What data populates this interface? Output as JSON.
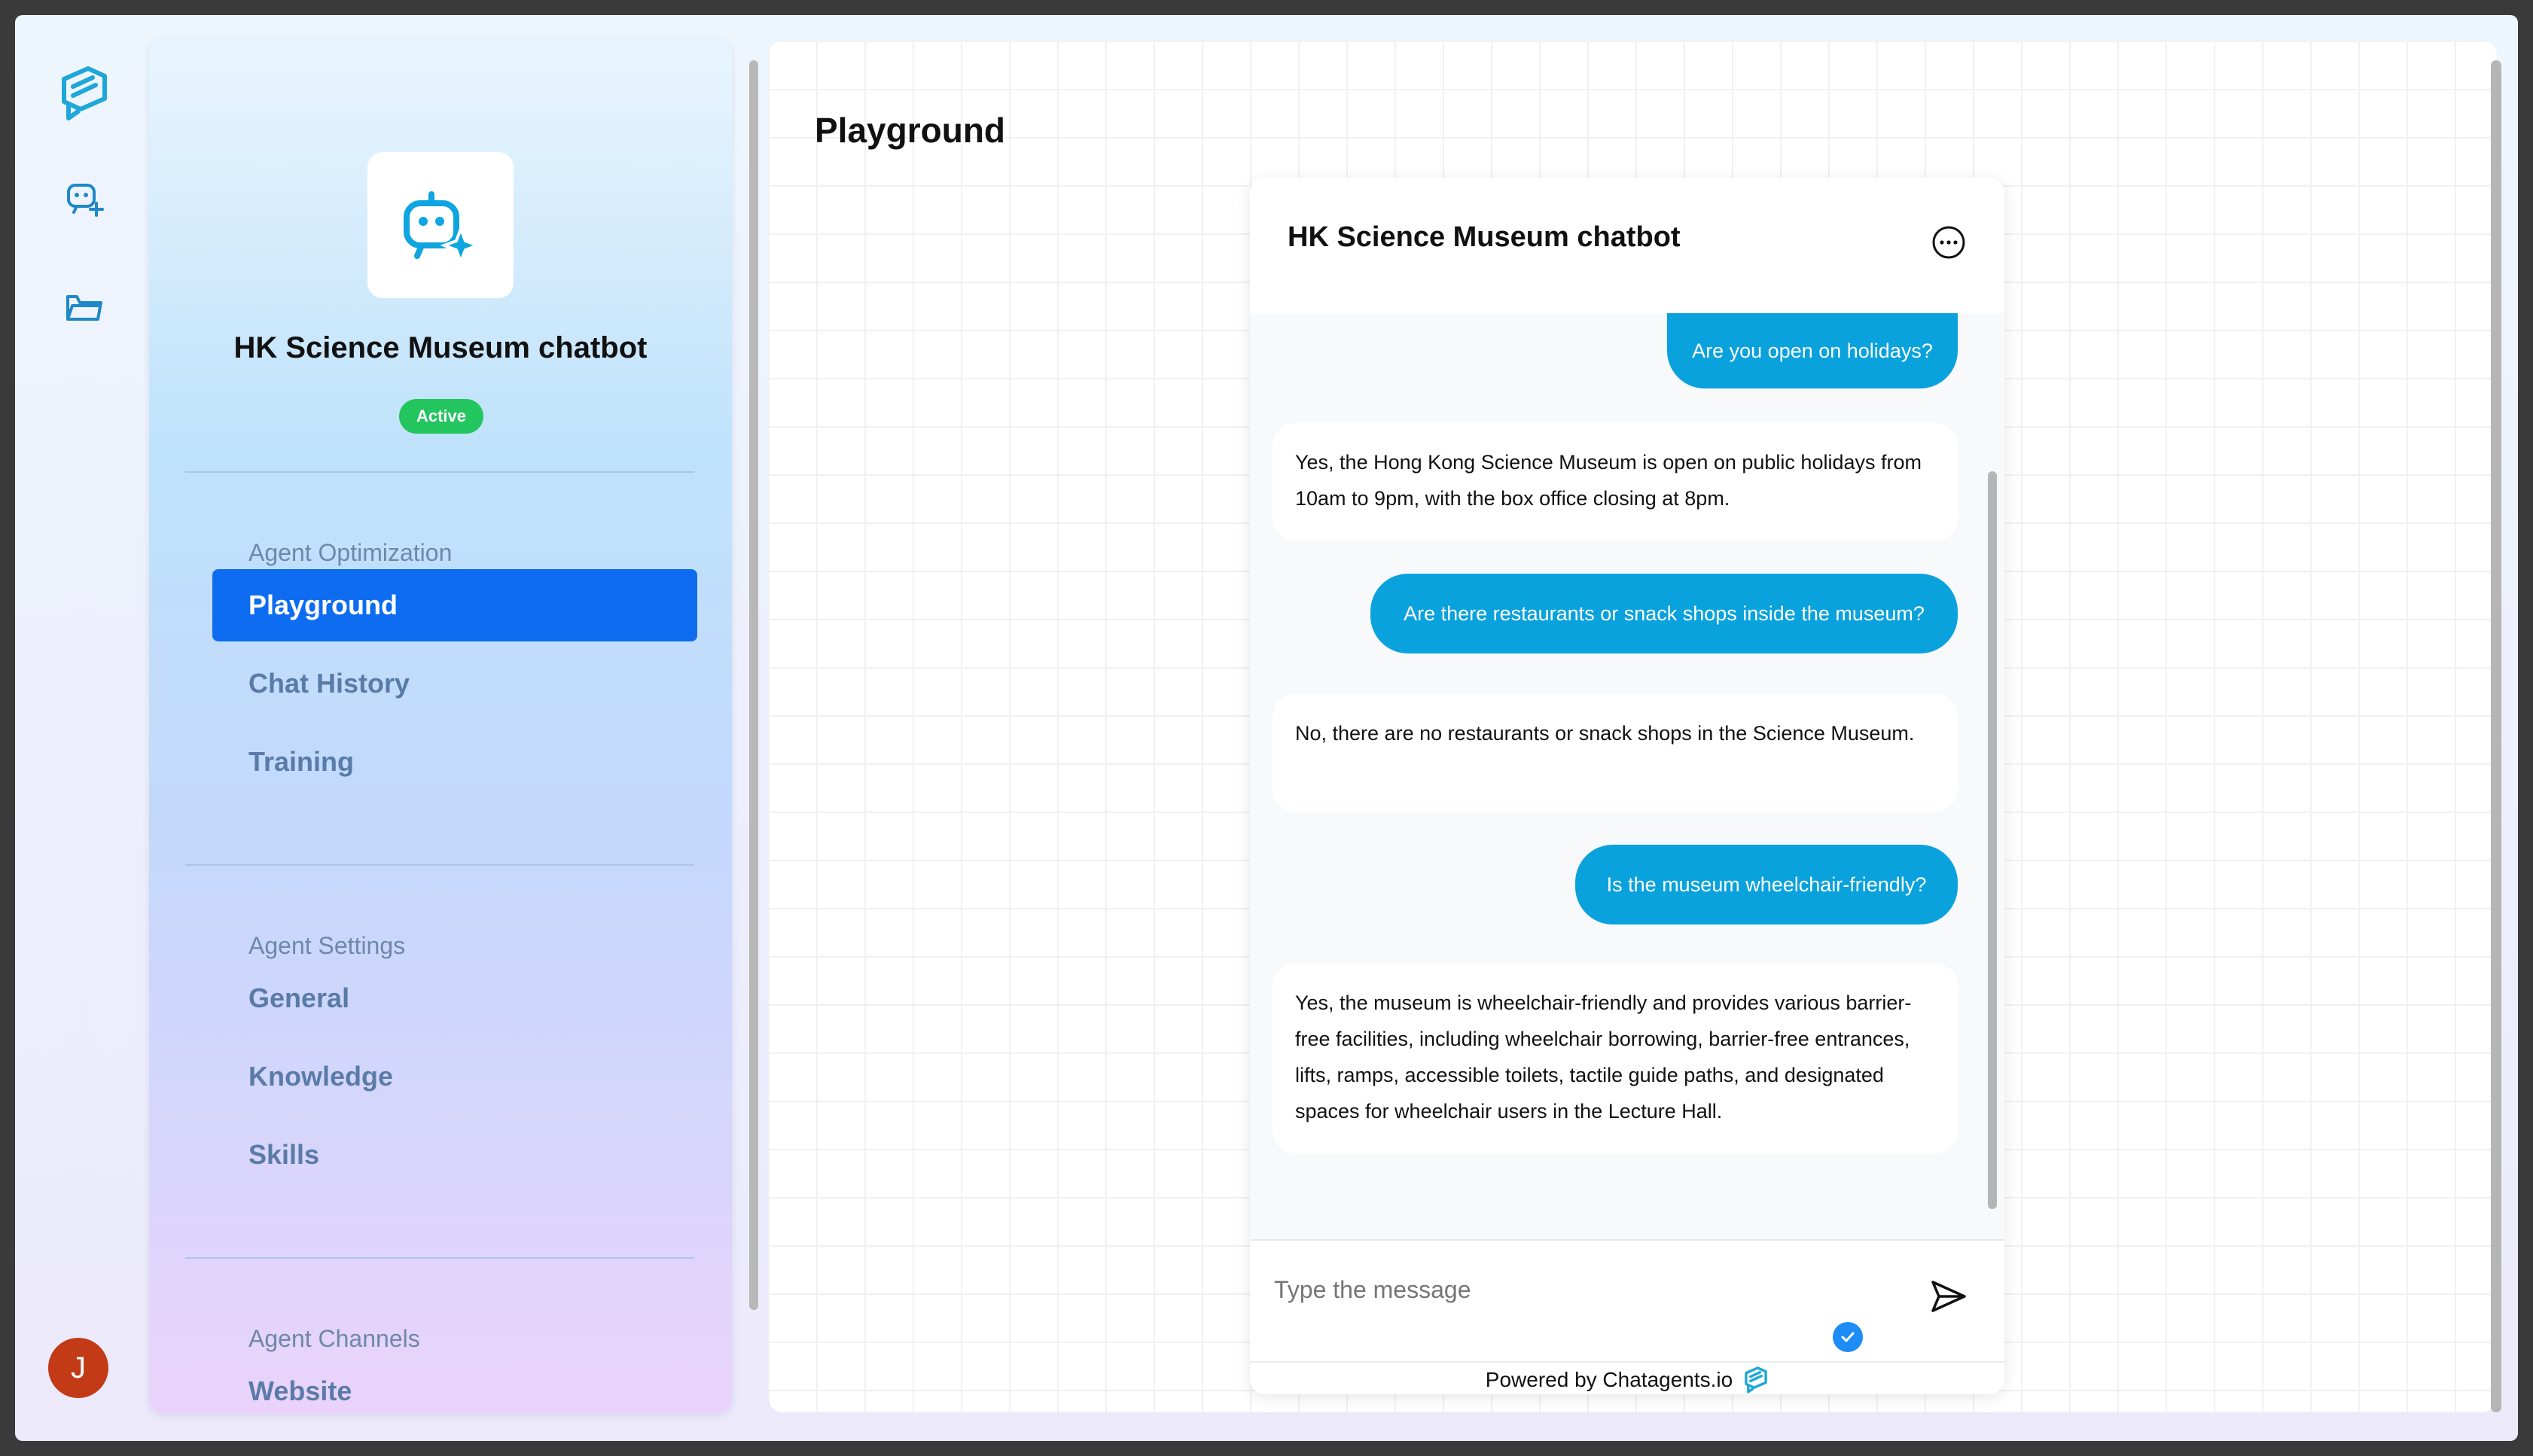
{
  "rail": {
    "icons": [
      "brand-logo-icon",
      "chatbot-add-icon",
      "folder-icon"
    ],
    "user_initial": "J"
  },
  "agent": {
    "name": "HK Science Museum chatbot",
    "status": "Active"
  },
  "sidebar": {
    "sections": [
      {
        "label": "Agent Optimization",
        "items": [
          "Playground",
          "Chat History",
          "Training"
        ]
      },
      {
        "label": "Agent Settings",
        "items": [
          "General",
          "Knowledge",
          "Skills"
        ]
      },
      {
        "label": "Agent Channels",
        "items": [
          "Website"
        ]
      }
    ],
    "active_item": "Playground"
  },
  "main": {
    "title": "Playground"
  },
  "chat": {
    "title": "HK Science Museum chatbot",
    "messages": [
      {
        "role": "user",
        "text": "Are you open on holidays?"
      },
      {
        "role": "bot",
        "text": "Yes, the Hong Kong Science Museum is open on public holidays from 10am to 9pm, with the box office closing at 8pm."
      },
      {
        "role": "user",
        "text": "Are there restaurants or snack shops inside the museum?"
      },
      {
        "role": "bot",
        "text": "No, there are no restaurants or snack shops in the Science Museum."
      },
      {
        "role": "user",
        "text": "Is the museum wheelchair-friendly?"
      },
      {
        "role": "bot",
        "text": "Yes, the museum is wheelchair-friendly and provides various barrier-free facilities, including wheelchair borrowing, barrier-free entrances, lifts, ramps, accessible toilets, tactile guide paths, and designated spaces for wheelchair users in the Lecture Hall."
      }
    ],
    "input_placeholder": "Type the message",
    "powered_by": "Powered by Chatagents.io"
  },
  "colors": {
    "accent": "#0d6cf0",
    "user_bubble": "#0aa2dc",
    "status_active": "#22c55e",
    "avatar": "#c23a16"
  }
}
